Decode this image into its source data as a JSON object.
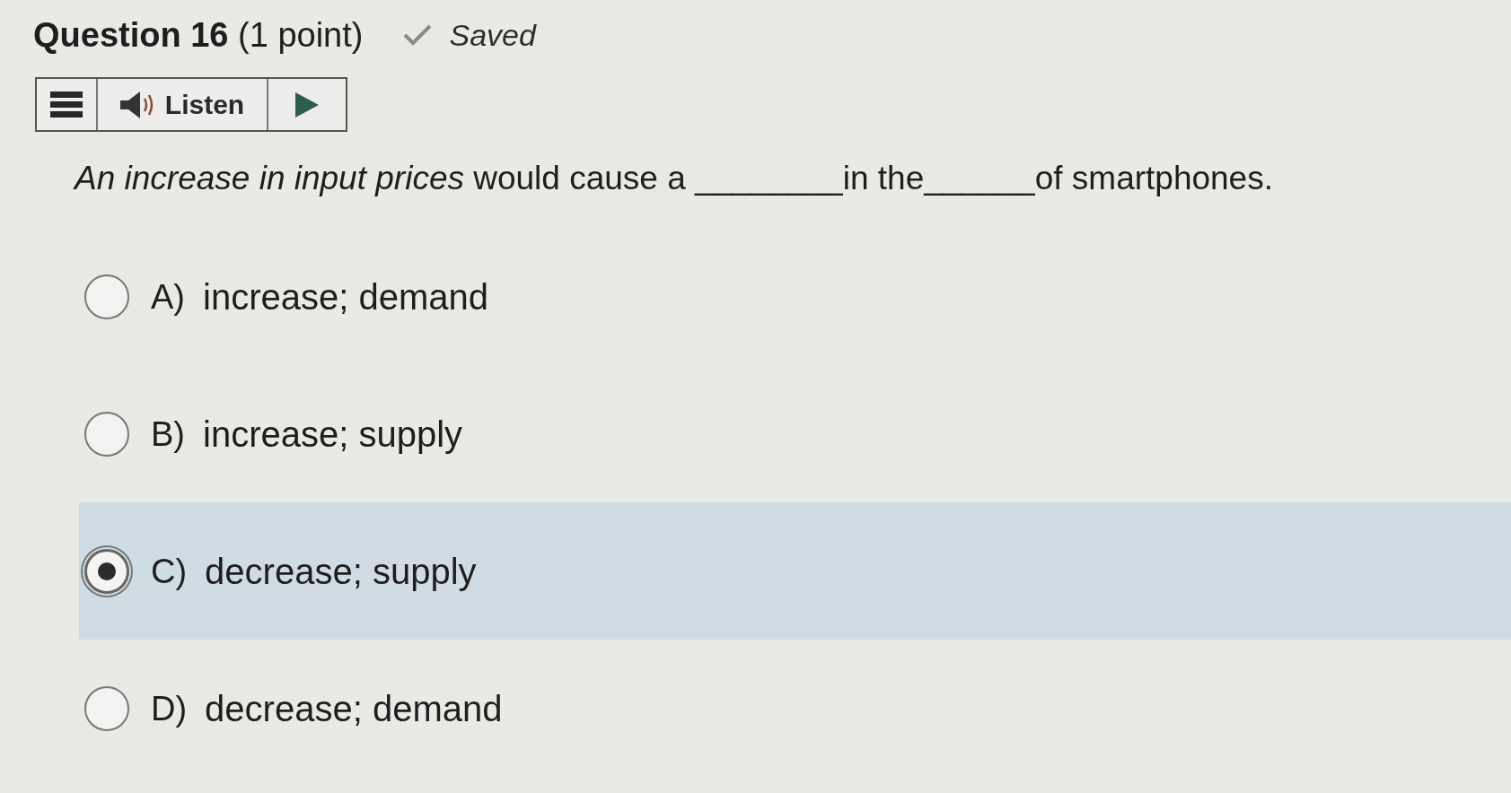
{
  "header": {
    "title": "**Question 16** (1 point)",
    "status": "Saved"
  },
  "toolbar": {
    "listen_label": "Listen"
  },
  "prompt": "*An increase in input prices* would cause a ________in the______of smartphones.",
  "options": [
    {
      "letter": "A)",
      "text": "increase; demand",
      "selected": false
    },
    {
      "letter": "B)",
      "text": "increase; supply",
      "selected": false
    },
    {
      "letter": "C)",
      "text": "decrease; supply",
      "selected": true
    },
    {
      "letter": "D)",
      "text": "decrease; demand",
      "selected": false
    }
  ]
}
